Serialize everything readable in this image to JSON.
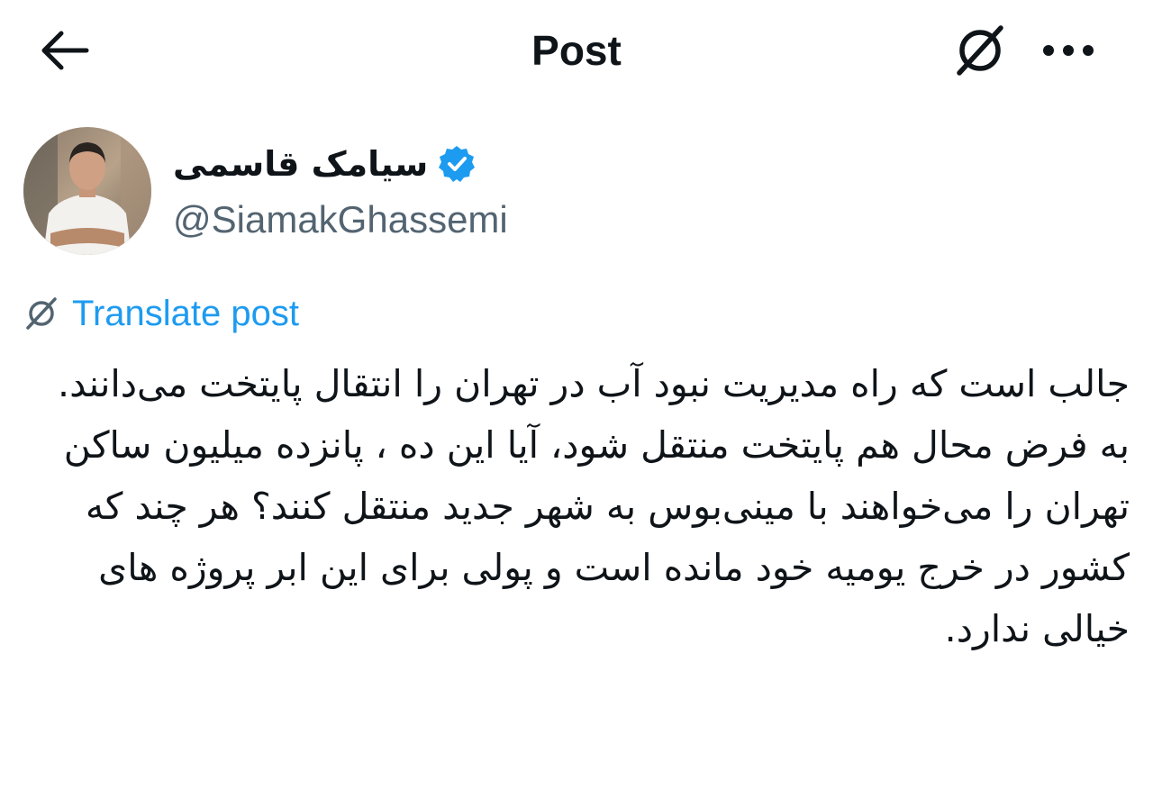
{
  "header": {
    "title": "Post",
    "back_icon": "arrow-left-icon",
    "grok_icon": "grok-icon",
    "more_icon": "more-horizontal-icon"
  },
  "author": {
    "name": "سیامک قاسمی",
    "handle": "@SiamakGhassemi",
    "verified": true,
    "verified_color": "#1d9bf0"
  },
  "translate": {
    "label": "Translate post",
    "icon": "grok-icon",
    "color": "#1d9bf0"
  },
  "post": {
    "paragraphs": [
      "جالب است که راه مدیریت نبود آب در تهران را انتقال پایتخت می‌دانند.",
      "به فرض محال هم پایتخت منتقل شود، آیا این ده ، پانزده میلیون ساکن تهران را می‌خواهند با مینی‌بوس به شهر جدید منتقل کنند؟ هر چند که کشور در خرج یومیه خود مانده است و پولی برای این ابر پروژه های خیالی ندارد."
    ]
  }
}
